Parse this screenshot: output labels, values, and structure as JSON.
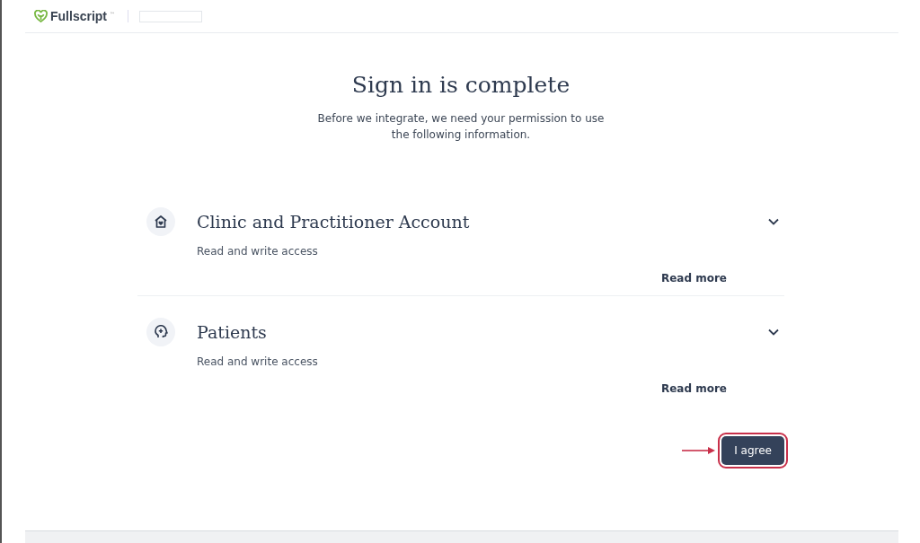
{
  "header": {
    "brand": "Fullscript",
    "brand_mark": "™"
  },
  "title": "Sign in is complete",
  "subtitle": "Before we integrate, we need your permission to use the following information.",
  "permissions": [
    {
      "kind": "clinic",
      "title": "Clinic and Practitioner Account",
      "access": "Read and write access",
      "link": "Read more",
      "expanded": false
    },
    {
      "kind": "patients",
      "title": "Patients",
      "access": "Read and write access",
      "link": "Read more",
      "expanded": false
    }
  ],
  "agree_button": {
    "label": "I agree",
    "highlighted": true
  }
}
